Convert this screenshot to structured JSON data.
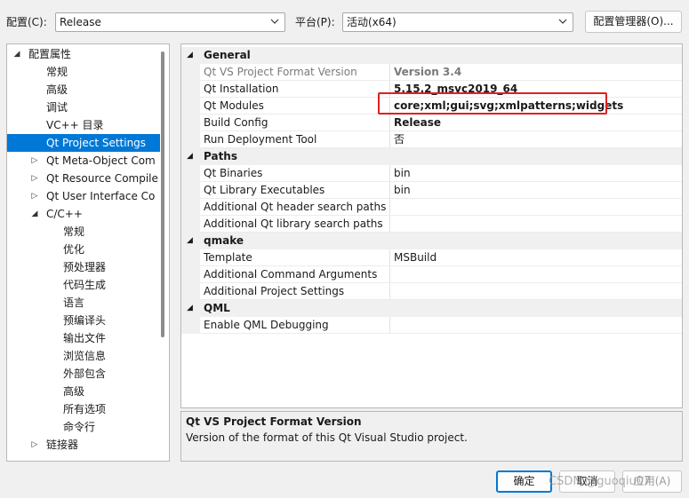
{
  "toolbar": {
    "config_label": "配置(C):",
    "config_value": "Release",
    "platform_label": "平台(P):",
    "platform_value": "活动(x64)",
    "config_manager_label": "配置管理器(O)..."
  },
  "tree": {
    "root": "配置属性",
    "items": [
      {
        "label": "常规"
      },
      {
        "label": "高级"
      },
      {
        "label": "调试"
      },
      {
        "label": "VC++ 目录"
      },
      {
        "label": "Qt Project Settings"
      },
      {
        "label": "Qt Meta-Object Com"
      },
      {
        "label": "Qt Resource Compile"
      },
      {
        "label": "Qt User Interface Co"
      },
      {
        "label": "C/C++"
      },
      {
        "label": "常规"
      },
      {
        "label": "优化"
      },
      {
        "label": "预处理器"
      },
      {
        "label": "代码生成"
      },
      {
        "label": "语言"
      },
      {
        "label": "预编译头"
      },
      {
        "label": "输出文件"
      },
      {
        "label": "浏览信息"
      },
      {
        "label": "外部包含"
      },
      {
        "label": "高级"
      },
      {
        "label": "所有选项"
      },
      {
        "label": "命令行"
      },
      {
        "label": "链接器"
      }
    ]
  },
  "grid": {
    "categories": [
      {
        "title": "General",
        "props": [
          {
            "name": "Qt VS Project Format Version",
            "value": "Version 3.4"
          },
          {
            "name": "Qt Installation",
            "value": "5.15.2_msvc2019_64"
          },
          {
            "name": "Qt Modules",
            "value": "core;xml;gui;svg;xmlpatterns;widgets"
          },
          {
            "name": "Build Config",
            "value": "Release"
          },
          {
            "name": "Run Deployment Tool",
            "value": "否"
          }
        ]
      },
      {
        "title": "Paths",
        "props": [
          {
            "name": "Qt Binaries",
            "value": "bin"
          },
          {
            "name": "Qt Library Executables",
            "value": "bin"
          },
          {
            "name": "Additional Qt header search paths",
            "value": ""
          },
          {
            "name": "Additional Qt library search paths",
            "value": ""
          }
        ]
      },
      {
        "title": "qmake",
        "props": [
          {
            "name": "Template",
            "value": "MSBuild"
          },
          {
            "name": "Additional Command Arguments",
            "value": ""
          },
          {
            "name": "Additional Project Settings",
            "value": ""
          }
        ]
      },
      {
        "title": "QML",
        "props": [
          {
            "name": "Enable QML Debugging",
            "value": ""
          }
        ]
      }
    ]
  },
  "description": {
    "title": "Qt VS Project Format Version",
    "text": "Version of the format of this Qt Visual Studio project."
  },
  "footer": {
    "ok_label": "确定",
    "cancel_label": "取消",
    "apply_label": "应用(A)",
    "watermark": "CSDN @guoqiu07"
  },
  "colors": {
    "selection": "#0078d7",
    "highlight_box": "#e02020"
  }
}
